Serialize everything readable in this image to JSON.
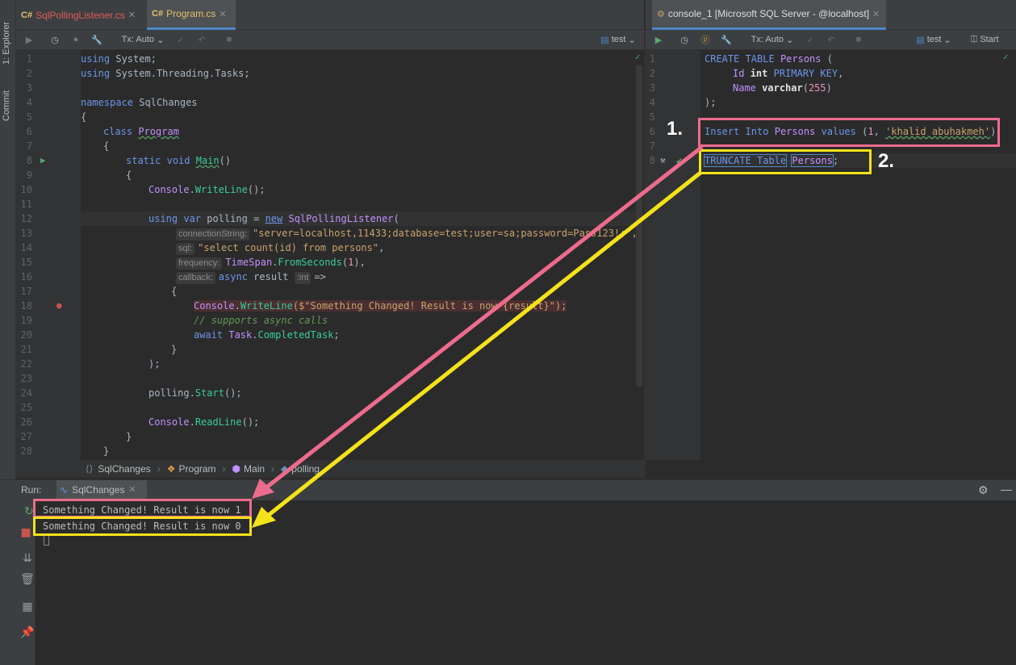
{
  "left_strip": {
    "explorer": "1: Explorer",
    "commit": "Commit"
  },
  "left_tabs": [
    {
      "lang": "C#",
      "name": "SqlPollingListener.cs"
    },
    {
      "lang": "C#",
      "name": "Program.cs"
    }
  ],
  "right_tab": {
    "name": "console_1 [Microsoft SQL Server - @localhost]"
  },
  "left_toolbar": {
    "tx": "Tx: Auto",
    "schema": "test"
  },
  "right_toolbar": {
    "tx": "Tx: Auto",
    "schema": "test",
    "start": "Start"
  },
  "code": {
    "line_numbers": [
      "1",
      "2",
      "3",
      "4",
      "5",
      "6",
      "7",
      "8",
      "9",
      "10",
      "11",
      "12",
      "13",
      "14",
      "15",
      "16",
      "17",
      "18",
      "19",
      "20",
      "21",
      "22",
      "23",
      "24",
      "25",
      "26",
      "27",
      "28"
    ],
    "l1a": "using",
    "l1b": "System",
    "l1c": ";",
    "l2a": "using",
    "l2b": "System",
    "l2c": ".",
    "l2d": "Threading",
    "l2e": ".",
    "l2f": "Tasks",
    "l2g": ";",
    "l4a": "namespace",
    "l4b": "SqlChanges",
    "l5": "{",
    "l6a": "class",
    "l6b": "Program",
    "l7": "{",
    "l8a": "static",
    "l8b": "void",
    "l8c": "Main",
    "l8d": "()",
    "l9": "{",
    "l10a": "Console",
    "l10b": ".",
    "l10c": "WriteLine",
    "l10d": "();",
    "l12a": "using",
    "l12b": "var",
    "l12c": "polling",
    "l12d": "=",
    "l12e": "new",
    "l12f": "SqlPollingListener",
    "l12g": "(",
    "l13h": "connectionString:",
    "l13a": "\"server=localhost,11433;database=test;user=sa;password=Pass123!;\",",
    "l14h": "sql:",
    "l14a": "\"select count(id) from persons\"",
    "l14b": ",",
    "l15h": "frequency:",
    "l15a": "TimeSpan",
    "l15b": ".",
    "l15c": "FromSeconds",
    "l15d": "(",
    "l15e": "1",
    "l15f": "),",
    "l16h": "callback:",
    "l16a": "async",
    "l16b": "result",
    "l16c": ":int",
    "l16d": "=>",
    "l17": "{",
    "l18a": "Console",
    "l18b": ".",
    "l18c": "WriteLine",
    "l18d": "($\"Something Changed! Result is now {result}\");",
    "l19": "// supports async calls",
    "l20a": "await",
    "l20b": "Task",
    "l20c": ".",
    "l20d": "CompletedTask",
    "l20e": ";",
    "l21": "}",
    "l22": ");",
    "l24a": "polling",
    "l24b": ".",
    "l24c": "Start",
    "l24d": "();",
    "l26a": "Console",
    "l26b": ".",
    "l26c": "ReadLine",
    "l26d": "();",
    "l27": "}",
    "l28": "}"
  },
  "sql": {
    "line_numbers": [
      "1",
      "2",
      "3",
      "4",
      "5",
      "6",
      "7",
      "8"
    ],
    "s1a": "CREATE TABLE",
    "s1b": "Persons",
    "s1c": "(",
    "s2a": "Id",
    "s2b": "int",
    "s2c": "PRIMARY KEY",
    "s2d": ",",
    "s3a": "Name",
    "s3b": "varchar",
    "s3c": "(",
    "s3d": "255",
    "s3e": ")",
    "s4": ");",
    "s6a": "Insert Into",
    "s6b": "Persons",
    "s6c": "values",
    "s6d": "(",
    "s6e": "1",
    "s6f": ",",
    "s6g": "'khalid abuhakmeh'",
    "s6h": ")",
    "s8a": "TRUNCATE Table",
    "s8b": "Persons",
    "s8c": ";"
  },
  "breadcrumb": [
    "SqlChanges",
    "Program",
    "Main",
    "polling"
  ],
  "run": {
    "label": "Run:",
    "config": "SqlChanges"
  },
  "console_lines": [
    "Something Changed! Result is now 1",
    "Something Changed! Result is now 0"
  ],
  "annotations": [
    "1.",
    "2."
  ],
  "colors": {
    "pink": "#ed6b8d",
    "yellow": "#f4e21a"
  }
}
